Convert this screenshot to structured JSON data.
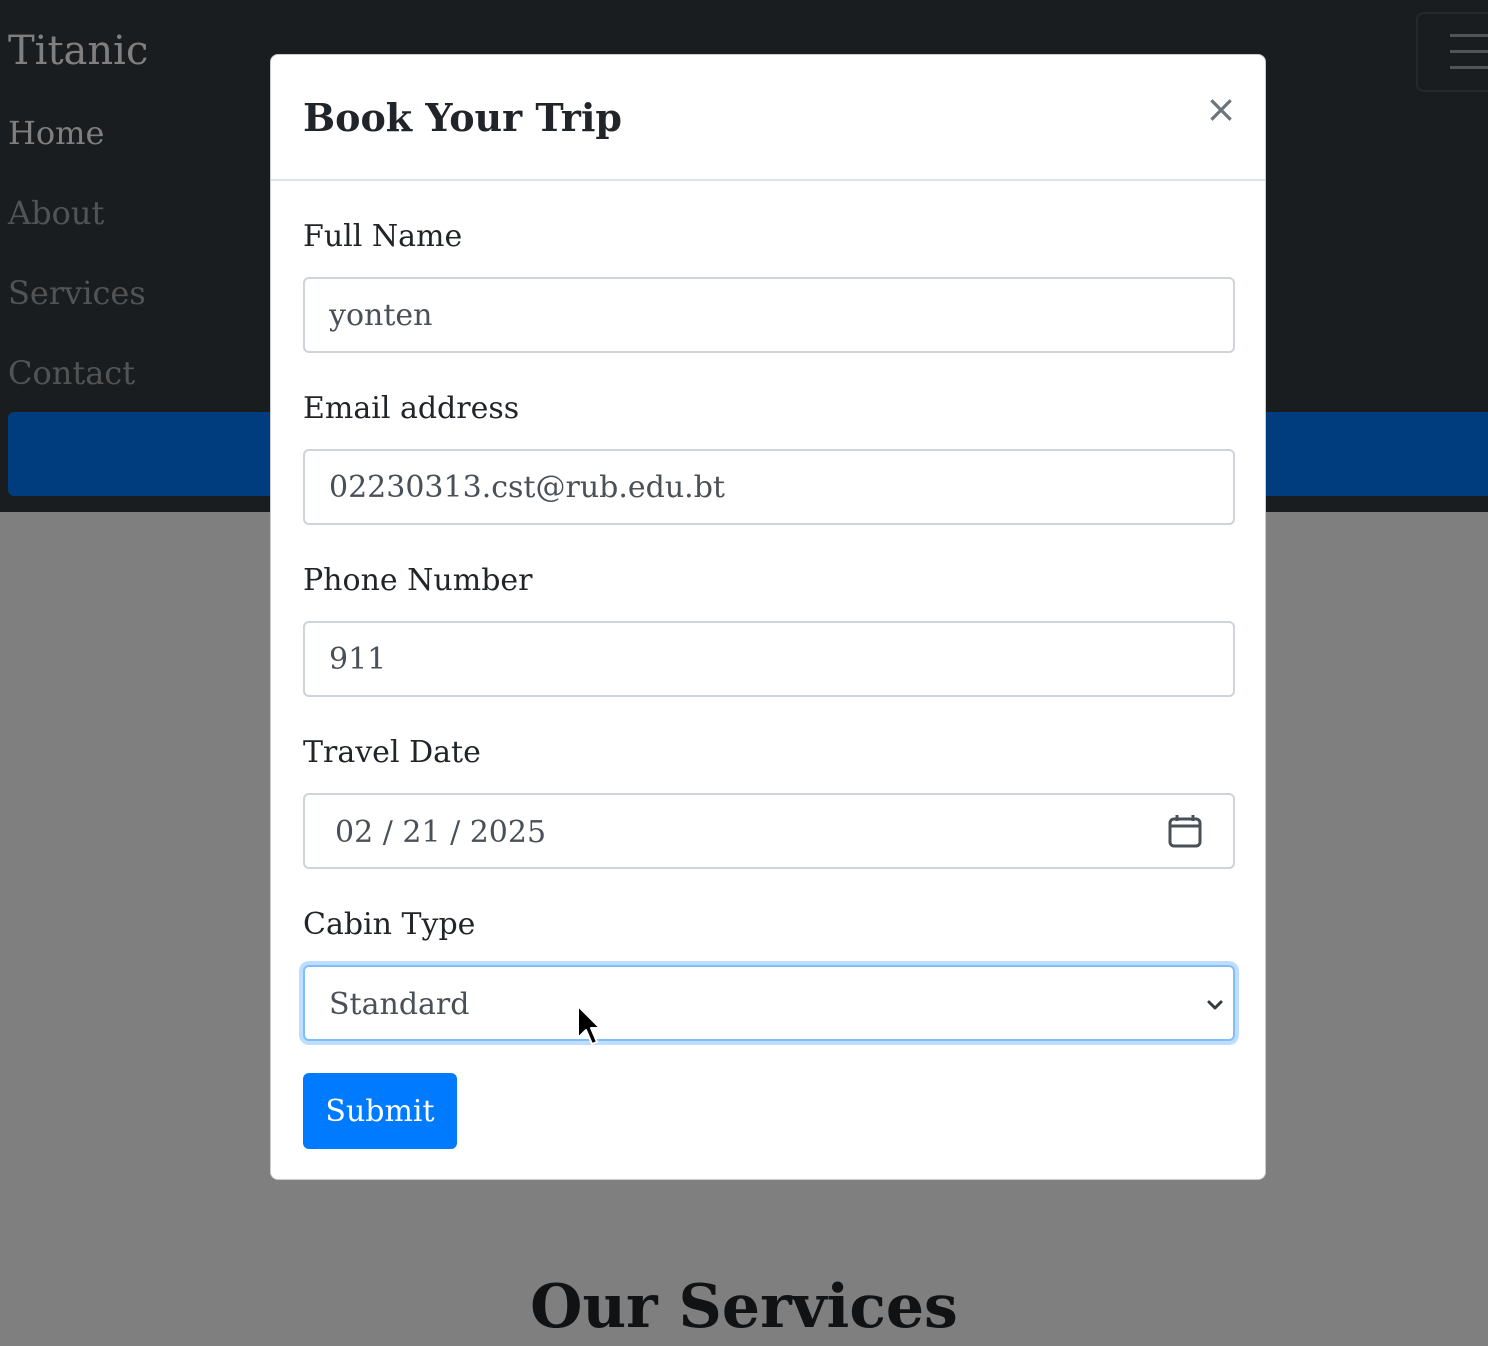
{
  "navbar": {
    "brand": "Titanic",
    "links": [
      {
        "label": "Home"
      },
      {
        "label": "About"
      },
      {
        "label": "Services"
      },
      {
        "label": "Contact"
      }
    ],
    "toggler_icon": "hamburger-menu-icon"
  },
  "page": {
    "section_title": "Our Services"
  },
  "modal": {
    "title": "Book Your Trip",
    "close_symbol": "×",
    "fields": {
      "full_name": {
        "label": "Full Name",
        "value": "yonten"
      },
      "email": {
        "label": "Email address",
        "value": "02230313.cst@rub.edu.bt"
      },
      "phone": {
        "label": "Phone Number",
        "value": "911"
      },
      "travel_date": {
        "label": "Travel Date",
        "value": "02 / 21 / 2025",
        "icon": "calendar-icon"
      },
      "cabin_type": {
        "label": "Cabin Type",
        "selected": "Standard",
        "icon": "chevron-down-icon"
      }
    },
    "submit_label": "Submit"
  },
  "colors": {
    "primary": "#007bff",
    "navbar_bg": "#343a40",
    "focus_ring": "#80bdff"
  }
}
